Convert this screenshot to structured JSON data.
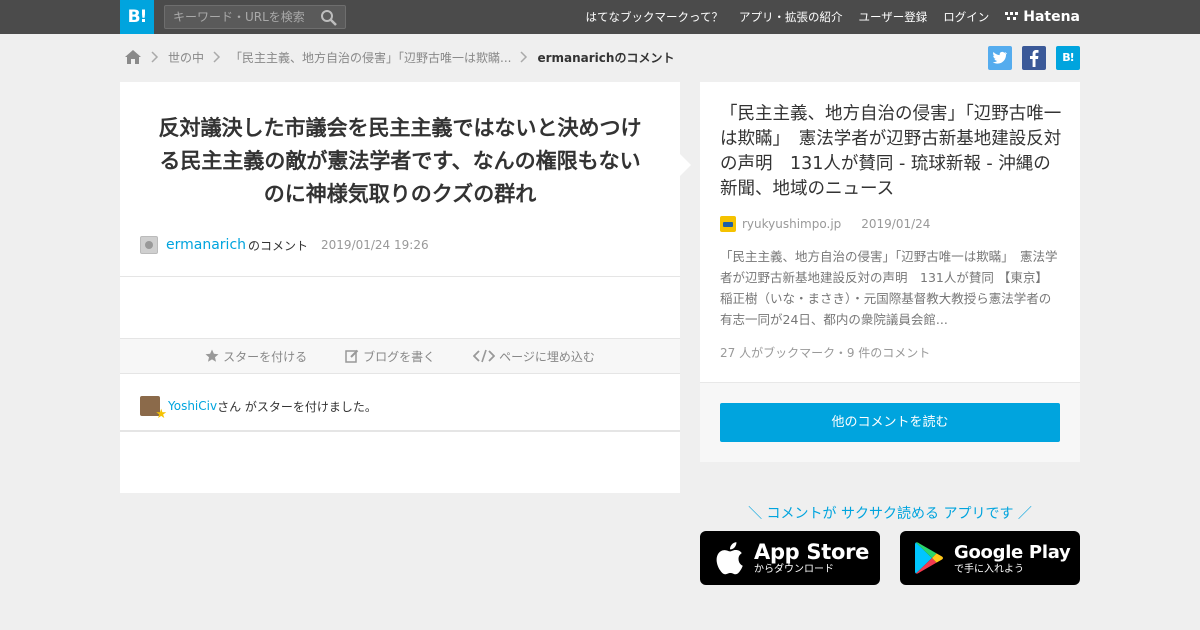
{
  "header": {
    "logo": "B!",
    "search_placeholder": "キーワード・URLを検索",
    "nav": [
      "はてなブックマークって？",
      "アプリ・拡張の紹介",
      "ユーザー登録",
      "ログイン"
    ],
    "brand": "Hatena"
  },
  "breadcrumb": {
    "items": [
      "世の中",
      "「民主主義、地方自治の侵害」「辺野古唯一は欺瞞..."
    ],
    "current": "ermanarichのコメント"
  },
  "share": {
    "hatena": "B!"
  },
  "comment": {
    "text": "反対議決した市議会を民主主義ではないと決めつける民主主義の敵が憲法学者です、なんの権限もないのに神様気取りのクズの群れ",
    "user": "ermanarich",
    "user_suffix": "のコメント",
    "date": "2019/01/24 19:26"
  },
  "actions": {
    "star": "スターを付ける",
    "blog": "ブログを書く",
    "embed": "ページに埋め込む"
  },
  "stars": {
    "user": "YoshiCiv",
    "text": "さん がスターを付けました。"
  },
  "entry": {
    "title": "「民主主義、地方自治の侵害」「辺野古唯一は欺瞞」　憲法学者が辺野古新基地建設反対の声明　131人が賛同 - 琉球新報 - 沖縄の新聞、地域のニュース",
    "site": "ryukyushimpo.jp",
    "date": "2019/01/24",
    "description": "「民主主義、地方自治の侵害」「辺野古唯一は欺瞞」　憲法学者が辺野古新基地建設反対の声明　131人が賛同 【東京】稲正樹（いな・まさき）・元国際基督教大教授ら憲法学者の有志一同が24日、都内の衆院議員会館...",
    "counts": "27 人がブックマーク・9 件のコメント",
    "read_more": "他のコメントを読む"
  },
  "promo": {
    "tagline": "＼ コメントが サクサク読める アプリです ／",
    "appstore_big": "App Store",
    "appstore_small": "からダウンロード",
    "googleplay_big": "Google Play",
    "googleplay_small": "で手に入れよう"
  },
  "colors": {
    "topbar": "#4b4b4b",
    "accent": "#00a4de",
    "background": "#efefef"
  }
}
